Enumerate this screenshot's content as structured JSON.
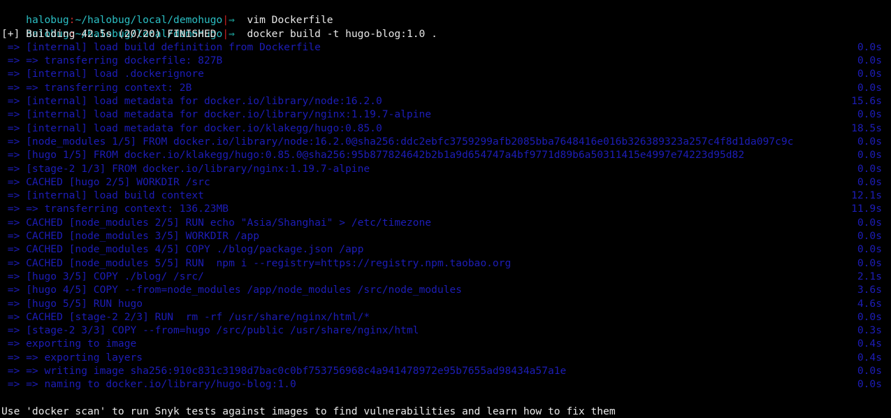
{
  "terminal": {
    "background_color": "#000000",
    "prompt_color": "#2bbfc4",
    "prompt_accent_color": "#cc2222",
    "output_color": "#1d1db8",
    "text_color": "#e8e8e8",
    "prompt": {
      "user": "halobug",
      "colon": ":",
      "path": "~/halobug/local/demohugo",
      "pipe": "|",
      "arrow": "⇒"
    },
    "commands": [
      {
        "text": "vim Dockerfile"
      },
      {
        "text": "docker build -t hugo-blog:1.0 ."
      }
    ],
    "build_header": "[+] Building 42.5s (20/20) FINISHED",
    "build_steps": [
      {
        "marker": " => ",
        "text": "[internal] load build definition from Dockerfile",
        "time": "0.0s"
      },
      {
        "marker": " => => ",
        "text": "transferring dockerfile: 827B",
        "time": "0.0s"
      },
      {
        "marker": " => ",
        "text": "[internal] load .dockerignore",
        "time": "0.0s"
      },
      {
        "marker": " => => ",
        "text": "transferring context: 2B",
        "time": "0.0s"
      },
      {
        "marker": " => ",
        "text": "[internal] load metadata for docker.io/library/node:16.2.0",
        "time": "15.6s"
      },
      {
        "marker": " => ",
        "text": "[internal] load metadata for docker.io/library/nginx:1.19.7-alpine",
        "time": "0.0s"
      },
      {
        "marker": " => ",
        "text": "[internal] load metadata for docker.io/klakegg/hugo:0.85.0",
        "time": "18.5s"
      },
      {
        "marker": " => ",
        "text": "[node_modules 1/5] FROM docker.io/library/node:16.2.0@sha256:ddc2ebfc3759299afb2085bba7648416e016b326389323a257c4f8d1da097c9c",
        "time": "0.0s"
      },
      {
        "marker": " => ",
        "text": "[hugo 1/5] FROM docker.io/klakegg/hugo:0.85.0@sha256:95b877824642b2b1a9d654747a4bf9771d89b6a50311415e4997e74223d95d82",
        "time": "0.0s"
      },
      {
        "marker": " => ",
        "text": "[stage-2 1/3] FROM docker.io/library/nginx:1.19.7-alpine",
        "time": "0.0s"
      },
      {
        "marker": " => ",
        "text": "CACHED [hugo 2/5] WORKDIR /src",
        "time": "0.0s"
      },
      {
        "marker": " => ",
        "text": "[internal] load build context",
        "time": "12.1s"
      },
      {
        "marker": " => => ",
        "text": "transferring context: 136.23MB",
        "time": "11.9s"
      },
      {
        "marker": " => ",
        "text": "CACHED [node_modules 2/5] RUN echo \"Asia/Shanghai\" > /etc/timezone",
        "time": "0.0s"
      },
      {
        "marker": " => ",
        "text": "CACHED [node_modules 3/5] WORKDIR /app",
        "time": "0.0s"
      },
      {
        "marker": " => ",
        "text": "CACHED [node_modules 4/5] COPY ./blog/package.json /app",
        "time": "0.0s"
      },
      {
        "marker": " => ",
        "text": "CACHED [node_modules 5/5] RUN  npm i --registry=https://registry.npm.taobao.org",
        "time": "0.0s"
      },
      {
        "marker": " => ",
        "text": "[hugo 3/5] COPY ./blog/ /src/",
        "time": "2.1s"
      },
      {
        "marker": " => ",
        "text": "[hugo 4/5] COPY --from=node_modules /app/node_modules /src/node_modules",
        "time": "3.6s"
      },
      {
        "marker": " => ",
        "text": "[hugo 5/5] RUN hugo",
        "time": "4.6s"
      },
      {
        "marker": " => ",
        "text": "CACHED [stage-2 2/3] RUN  rm -rf /usr/share/nginx/html/*",
        "time": "0.0s"
      },
      {
        "marker": " => ",
        "text": "[stage-2 3/3] COPY --from=hugo /src/public /usr/share/nginx/html",
        "time": "0.3s"
      },
      {
        "marker": " => ",
        "text": "exporting to image",
        "time": "0.4s"
      },
      {
        "marker": " => => ",
        "text": "exporting layers",
        "time": "0.4s"
      },
      {
        "marker": " => => ",
        "text": "writing image sha256:910c831c3198d7bac0c0bf753756968c4a941478972e95b7655ad98434a57a1e",
        "time": "0.0s"
      },
      {
        "marker": " => => ",
        "text": "naming to docker.io/library/hugo-blog:1.0",
        "time": "0.0s"
      }
    ],
    "footer_note": "Use 'docker scan' to run Snyk tests against images to find vulnerabilities and learn how to fix them"
  }
}
